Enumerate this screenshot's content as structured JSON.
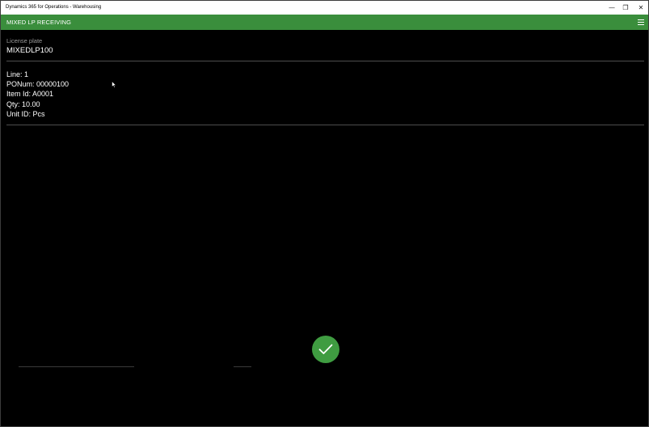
{
  "window": {
    "title": "Dynamics 365 for Operations - Warehousing",
    "minimize_glyph": "—",
    "maximize_glyph": "❐",
    "close_glyph": "✕"
  },
  "appbar": {
    "title": "MIXED LP RECEIVING",
    "menu_icon": "hamburger-icon"
  },
  "license_plate": {
    "label": "License plate",
    "value": "MIXEDLP100"
  },
  "details": {
    "line": "Line: 1",
    "ponum": "PONum: 00000100",
    "item_id": "Item Id: A0001",
    "qty": "Qty: 10.00",
    "unit_id": "Unit ID: Pcs"
  },
  "actions": {
    "ok_icon": "checkmark-icon"
  },
  "colors": {
    "accent": "#3a8e3c",
    "ok_button": "#3f9c41",
    "background": "#000000"
  }
}
